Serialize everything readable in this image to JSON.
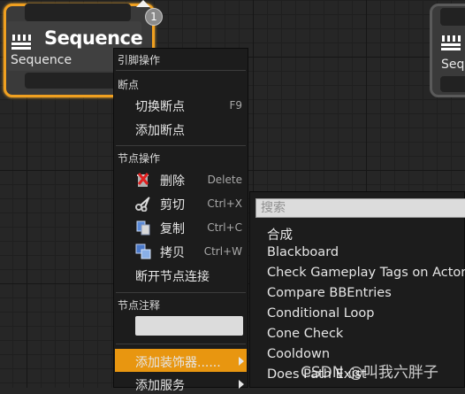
{
  "node": {
    "title": "Sequence",
    "subtitle": "Sequence",
    "badge": "1",
    "icon": "sequence-icon",
    "accent": "#f0a020"
  },
  "node2": {
    "subtitle": "Seq",
    "icon": "sequence-icon"
  },
  "menu": {
    "header_pin": "引脚操作",
    "header_breakpoint": "断点",
    "toggle_breakpoint": "切换断点",
    "toggle_breakpoint_shortcut": "F9",
    "add_breakpoint": "添加断点",
    "header_node_actions": "节点操作",
    "delete": "删除",
    "delete_shortcut": "Delete",
    "cut": "剪切",
    "cut_shortcut": "Ctrl+X",
    "copy": "复制",
    "copy_shortcut": "Ctrl+C",
    "duplicate": "拷贝",
    "duplicate_shortcut": "Ctrl+W",
    "break_links": "断开节点连接",
    "header_comment": "节点注释",
    "add_decorator": "添加装饰器......",
    "add_service": "添加服务",
    "highlight": "#e89610"
  },
  "submenu": {
    "search_placeholder": "搜索",
    "items": [
      "合成",
      "Blackboard",
      "Check Gameplay Tags on Actor",
      "Compare BBEntries",
      "Conditional Loop",
      "Cone Check",
      "Cooldown",
      "Does Path Exist"
    ]
  },
  "watermark": "CSDN @叫我六胖子"
}
